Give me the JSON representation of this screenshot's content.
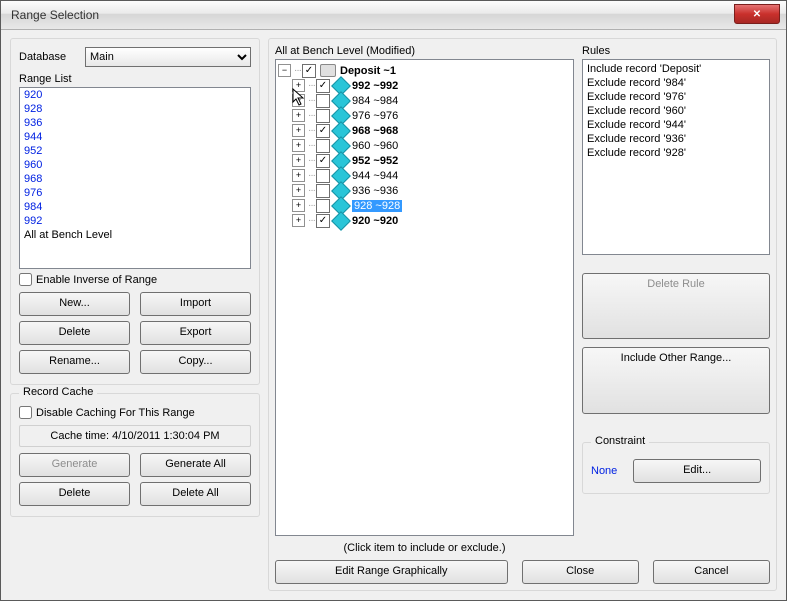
{
  "title": "Range Selection",
  "left": {
    "database_label": "Database",
    "database_value": "Main",
    "rangelist_label": "Range List",
    "range_items": [
      "920",
      "928",
      "936",
      "944",
      "952",
      "960",
      "968",
      "976",
      "984",
      "992",
      "All at Bench Level"
    ],
    "inverse_label": "Enable Inverse of Range",
    "buttons": {
      "new": "New...",
      "import": "Import",
      "delete": "Delete",
      "export": "Export",
      "rename": "Rename...",
      "copy": "Copy..."
    }
  },
  "cache": {
    "group_label": "Record Cache",
    "disable_label": "Disable Caching For This Range",
    "time_text": "Cache time: 4/10/2011 1:30:04 PM",
    "generate": "Generate",
    "generate_all": "Generate All",
    "delete": "Delete",
    "delete_all": "Delete All"
  },
  "mid": {
    "header": "All at Bench Level (Modified)",
    "root_label": "Deposit   ~1",
    "nodes": [
      {
        "checked": true,
        "label": "992  ~992",
        "bold": true,
        "sel": false
      },
      {
        "checked": false,
        "label": "984  ~984",
        "bold": false,
        "sel": false
      },
      {
        "checked": false,
        "label": "976  ~976",
        "bold": false,
        "sel": false
      },
      {
        "checked": true,
        "label": "968  ~968",
        "bold": true,
        "sel": false
      },
      {
        "checked": false,
        "label": "960  ~960",
        "bold": false,
        "sel": false
      },
      {
        "checked": true,
        "label": "952  ~952",
        "bold": true,
        "sel": false
      },
      {
        "checked": false,
        "label": "944  ~944",
        "bold": false,
        "sel": false
      },
      {
        "checked": false,
        "label": "936  ~936",
        "bold": false,
        "sel": false
      },
      {
        "checked": false,
        "label": "928  ~928",
        "bold": false,
        "sel": true
      },
      {
        "checked": true,
        "label": "920  ~920",
        "bold": true,
        "sel": false
      }
    ],
    "hint": "(Click item to include or exclude.)",
    "edit_graph": "Edit Range Graphically",
    "close": "Close",
    "cancel": "Cancel"
  },
  "rules": {
    "label": "Rules",
    "items": [
      "Include  record 'Deposit'",
      "Exclude  record '984'",
      "Exclude  record '976'",
      "Exclude  record '960'",
      "Exclude  record '944'",
      "Exclude  record '936'",
      "Exclude  record '928'"
    ],
    "delete_rule": "Delete Rule",
    "include_other": "Include Other Range...",
    "constraint_label": "Constraint",
    "constraint_value": "None",
    "edit": "Edit..."
  }
}
